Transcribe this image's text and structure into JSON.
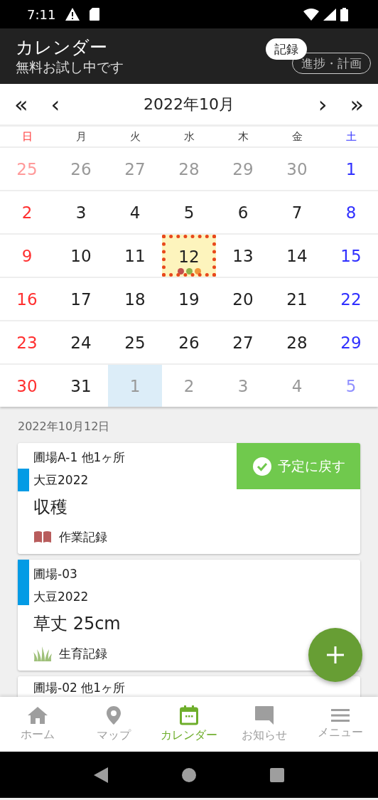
{
  "status_bar": {
    "time": "7:11"
  },
  "header": {
    "title": "カレンダー",
    "subtitle": "無料お試し中です",
    "buttons": [
      {
        "label": "記録",
        "selected": true
      },
      {
        "label": "進捗・計画",
        "selected": false
      }
    ]
  },
  "month_nav": {
    "first": "«",
    "prev": "‹",
    "title": "2022年10月",
    "next": "›",
    "last": "»"
  },
  "weekdays": [
    "日",
    "月",
    "火",
    "水",
    "木",
    "金",
    "土"
  ],
  "weeks": [
    [
      {
        "day": "25",
        "current": false
      },
      {
        "day": "26",
        "current": false
      },
      {
        "day": "27",
        "current": false
      },
      {
        "day": "28",
        "current": false
      },
      {
        "day": "29",
        "current": false
      },
      {
        "day": "30",
        "current": false
      },
      {
        "day": "1",
        "current": true
      }
    ],
    [
      {
        "day": "2",
        "current": true
      },
      {
        "day": "3",
        "current": true
      },
      {
        "day": "4",
        "current": true
      },
      {
        "day": "5",
        "current": true
      },
      {
        "day": "6",
        "current": true
      },
      {
        "day": "7",
        "current": true
      },
      {
        "day": "8",
        "current": true
      }
    ],
    [
      {
        "day": "9",
        "current": true
      },
      {
        "day": "10",
        "current": true
      },
      {
        "day": "11",
        "current": true
      },
      {
        "day": "12",
        "current": true,
        "selected": true,
        "events": [
          {
            "color": "#c0504d"
          },
          {
            "color": "#8db24a"
          },
          {
            "color": "#f0963c"
          }
        ]
      },
      {
        "day": "13",
        "current": true
      },
      {
        "day": "14",
        "current": true
      },
      {
        "day": "15",
        "current": true
      }
    ],
    [
      {
        "day": "16",
        "current": true
      },
      {
        "day": "17",
        "current": true
      },
      {
        "day": "18",
        "current": true
      },
      {
        "day": "19",
        "current": true
      },
      {
        "day": "20",
        "current": true
      },
      {
        "day": "21",
        "current": true
      },
      {
        "day": "22",
        "current": true
      }
    ],
    [
      {
        "day": "23",
        "current": true
      },
      {
        "day": "24",
        "current": true
      },
      {
        "day": "25",
        "current": true
      },
      {
        "day": "26",
        "current": true
      },
      {
        "day": "27",
        "current": true
      },
      {
        "day": "28",
        "current": true
      },
      {
        "day": "29",
        "current": true
      }
    ],
    [
      {
        "day": "30",
        "current": true
      },
      {
        "day": "31",
        "current": true
      },
      {
        "day": "1",
        "current": false,
        "today": true
      },
      {
        "day": "2",
        "current": false
      },
      {
        "day": "3",
        "current": false
      },
      {
        "day": "4",
        "current": false
      },
      {
        "day": "5",
        "current": false
      }
    ]
  ],
  "date_label": "2022年10月12日",
  "records": [
    {
      "location": "圃場A-1 他1ヶ所",
      "crop": "大豆2022",
      "title": "収穫",
      "kind": "work",
      "record_label": "作業記録",
      "action": "予定に戻す"
    },
    {
      "location": "圃場-03",
      "crop": "大豆2022",
      "title": "草丈 25cm",
      "kind": "growth",
      "record_label": "生育記録"
    },
    {
      "location": "圃場-02 他1ヶ所"
    }
  ],
  "bottom_nav": [
    {
      "kind": "home",
      "label": "ホーム",
      "selected": false
    },
    {
      "kind": "map",
      "label": "マップ",
      "selected": false
    },
    {
      "kind": "calendar",
      "label": "カレンダー",
      "selected": true
    },
    {
      "kind": "notice",
      "label": "お知らせ",
      "selected": false
    },
    {
      "kind": "menu",
      "label": "メニュー",
      "selected": false
    }
  ]
}
